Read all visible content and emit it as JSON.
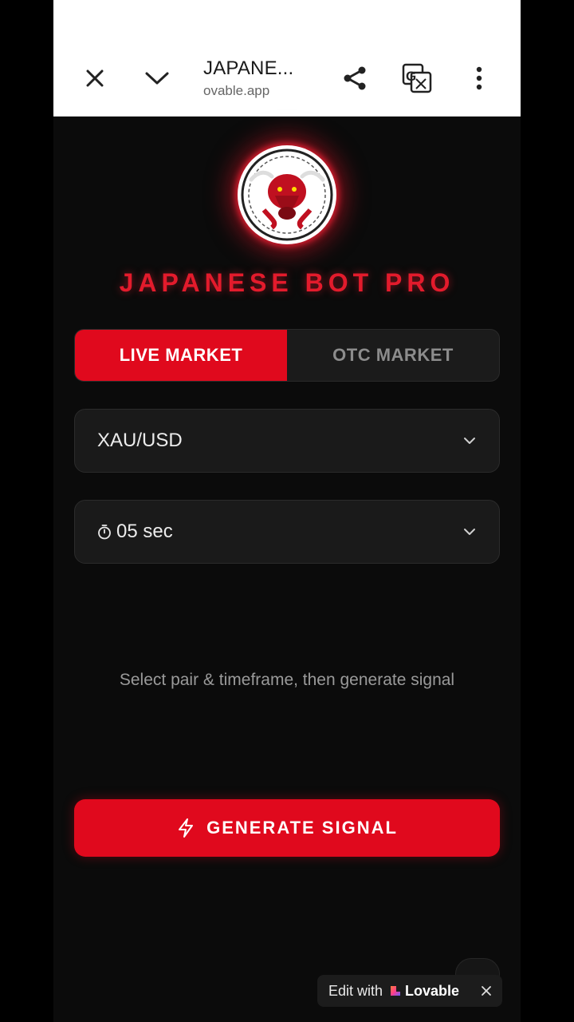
{
  "browser": {
    "title": "JAPANE...",
    "url": "ovable.app"
  },
  "app": {
    "brand_title": "JAPANESE BOT PRO",
    "market_tabs": [
      {
        "label": "LIVE MARKET",
        "active": true
      },
      {
        "label": "OTC MARKET",
        "active": false
      }
    ],
    "pair_select": {
      "value": "XAU/USD"
    },
    "timeframe_select": {
      "icon": "stopwatch-icon",
      "value": "05 sec"
    },
    "hint": "Select pair & timeframe, then generate signal",
    "generate_button": {
      "icon": "lightning-icon",
      "label": "GENERATE SIGNAL"
    }
  },
  "lovable_badge": {
    "prefix": "Edit with",
    "brand": "Lovable"
  },
  "colors": {
    "accent": "#e0091d",
    "background": "#0b0b0b",
    "panel": "#1a1a1a"
  }
}
